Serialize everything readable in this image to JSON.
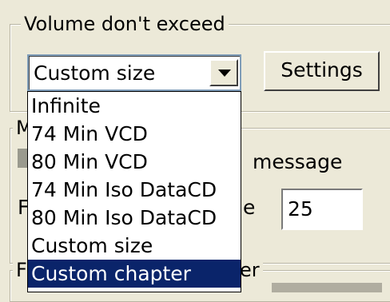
{
  "volume_group": {
    "legend": "Volume don't exceed",
    "combo_value": "Custom size",
    "settings_label": "Settings"
  },
  "dropdown": {
    "items": [
      "Infinite",
      "74 Min VCD",
      "80 Min VCD",
      "74 Min Iso DataCD",
      "80 Min Iso DataCD",
      "Custom size",
      "Custom chapter"
    ],
    "selected_index": 6
  },
  "background_partial": {
    "message_label": "message",
    "number_value": "25",
    "legend_partial": "er",
    "group_fragment_1": "M",
    "group_fragment_2": "F",
    "label_fragment": "e",
    "group_fragment_3": "F"
  },
  "colors": {
    "face": "#ece9d8",
    "highlight": "#0a246a"
  },
  "icons": {
    "combo_arrow": "chevron-down-icon"
  }
}
